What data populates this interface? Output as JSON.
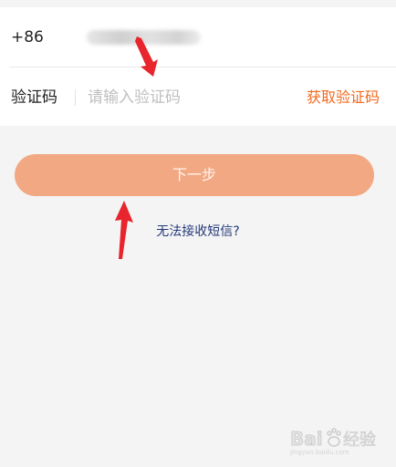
{
  "form": {
    "country_code": "+86",
    "code_label": "验证码",
    "code_placeholder": "请输入验证码",
    "code_value": "",
    "get_code_label": "获取验证码"
  },
  "actions": {
    "next_label": "下一步",
    "no_sms_label": "无法接收短信?"
  },
  "annotations": {
    "arrow_color": "#e8252c"
  },
  "watermark": {
    "brand": "Baidu 经验",
    "icon": "baidu-paw-icon"
  },
  "colors": {
    "background": "#f4f4f4",
    "accent_orange": "#f06a1f",
    "button_fill": "#f2a983",
    "link_blue": "#243a7a"
  }
}
